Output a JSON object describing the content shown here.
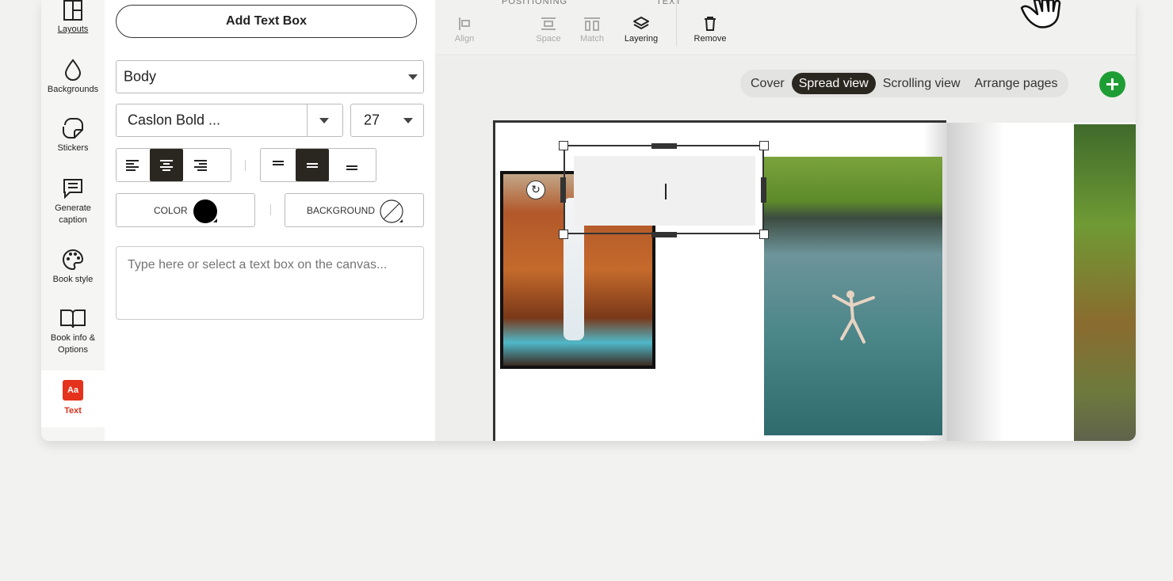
{
  "sidebar": {
    "items": [
      {
        "label": "Layouts",
        "icon": "layouts-icon"
      },
      {
        "label": "Backgrounds",
        "icon": "drop-icon"
      },
      {
        "label": "Stickers",
        "icon": "sticker-icon"
      },
      {
        "label": "Generate caption",
        "icon": "caption-icon"
      },
      {
        "label": "Book style",
        "icon": "palette-icon"
      },
      {
        "label": "Book info & Options",
        "icon": "book-icon"
      },
      {
        "label": "Text",
        "icon": "text-aa-icon",
        "glyph": "Aa",
        "active": true
      }
    ]
  },
  "panel": {
    "add_text_box": "Add Text Box",
    "style_select": "Body",
    "font_select": "Caslon Bold ...",
    "size_select": "27",
    "align_selected": "center",
    "spacing_selected": "medium",
    "color_label": "COLOR",
    "background_label": "BACKGROUND",
    "color_value": "#000000",
    "textarea_placeholder": "Type here or select a text box on the canvas..."
  },
  "toolbar": {
    "positioning_title": "POSITIONING",
    "text_title": "TEXT",
    "align": "Align",
    "space": "Space",
    "match": "Match",
    "layering": "Layering",
    "remove": "Remove"
  },
  "views": {
    "tabs": [
      "Cover",
      "Spread view",
      "Scrolling view",
      "Arrange pages"
    ],
    "active": "Spread view"
  },
  "colors": {
    "accent_dark": "#2a2620",
    "active_red": "#e5321c",
    "add_green": "#1f9d35"
  }
}
